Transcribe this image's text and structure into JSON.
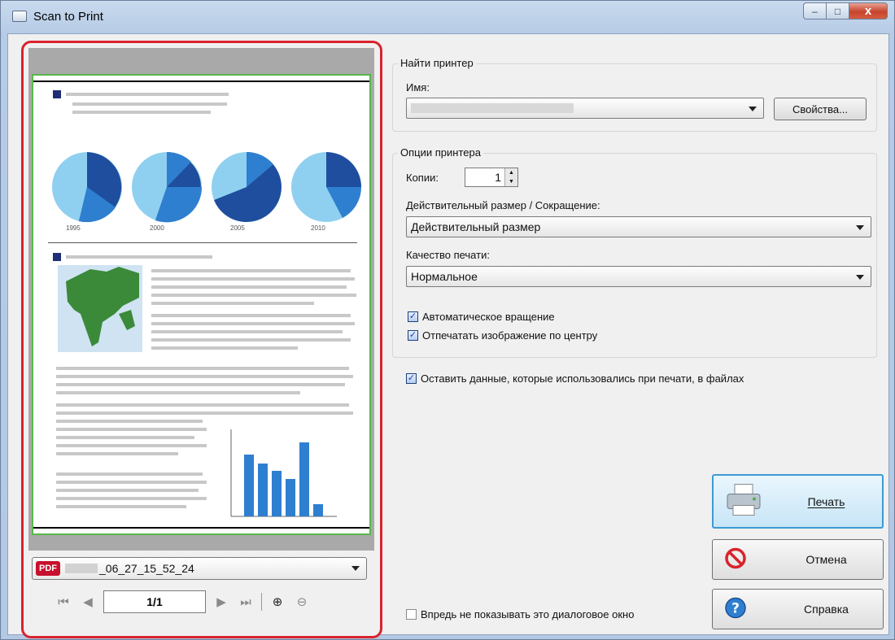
{
  "window": {
    "title": "Scan to Print",
    "min": "–",
    "max": "□",
    "close": "x"
  },
  "preview": {
    "years": [
      "1995",
      "2000",
      "2005",
      "2010"
    ],
    "file_label": "PDF",
    "file_name": "_06_27_15_52_24",
    "page_value": "1/1",
    "icons": [
      "first-page-icon",
      "prev-page-icon",
      "next-page-icon",
      "last-page-icon",
      "zoom-in-icon",
      "zoom-out-icon"
    ]
  },
  "find_printer": {
    "title": "Найти принтер",
    "name_label": "Имя:",
    "properties_button": "Свойства..."
  },
  "printer_options": {
    "title": "Опции принтера",
    "copies_label": "Копии:",
    "copies_value": "1",
    "size_label": "Действительный размер / Сокращение:",
    "size_value": "Действительный размер",
    "quality_label": "Качество печати:",
    "quality_value": "Нормальное",
    "auto_rotate": "Автоматическое вращение",
    "center_image": "Отпечатать изображение по центру"
  },
  "keep_data": "Оставить данные, которые использовались при печати, в файлах",
  "dont_show": "Впредь не показывать это диалоговое окно",
  "buttons": {
    "print": "Печать",
    "cancel": "Отмена",
    "help": "Справка"
  },
  "colors": {
    "accent_red": "#d9232e",
    "page_border": "#57b84a",
    "primary_button": "#3d9ad4"
  }
}
